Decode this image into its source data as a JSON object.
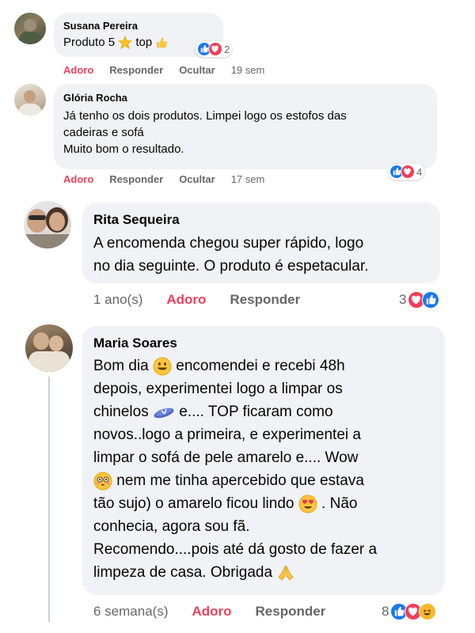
{
  "comments": [
    {
      "author": "Susana Pereira",
      "lines": [
        "Produto 5",
        "top"
      ],
      "actions": {
        "like": "Adoro",
        "reply": "Responder",
        "hide": "Ocultar",
        "time": "19 sem"
      },
      "reactions": {
        "count": "2",
        "types": [
          "like-icon",
          "love-icon"
        ]
      }
    },
    {
      "author": "Glória Rocha",
      "lines": [
        "Já tenho os dois produtos. Limpei logo os estofos das",
        "cadeiras e sofá",
        "Muito bom o resultado."
      ],
      "actions": {
        "like": "Adoro",
        "reply": "Responder",
        "hide": "Ocultar",
        "time": "17 sem"
      },
      "reactions": {
        "count": "4",
        "types": [
          "like-icon",
          "love-icon"
        ]
      }
    },
    {
      "author": "Rita Sequeira",
      "lines": [
        "A encomenda chegou super rápido, logo",
        "no dia seguinte. O produto é espetacular."
      ],
      "actions": {
        "time": "1 ano(s)",
        "like": "Adoro",
        "reply": "Responder"
      },
      "reactions": {
        "count": "3",
        "types": [
          "love-icon",
          "like-icon"
        ]
      }
    },
    {
      "author": "Maria Soares",
      "lines": [
        "Bom dia",
        "encomendei e recebi 48h",
        "depois, experimentei logo a limpar os",
        "chinelos",
        "e.... TOP ficaram como",
        "novos..logo a primeira, e experimentei a",
        "limpar o sofá de pele amarelo e.... Wow",
        "nem me tinha apercebido que estava",
        "tão sujo) o amarelo ficou lindo",
        ". Não",
        "conhecia, agora sou fã.",
        "Recomendo....pois até dá gosto de fazer a",
        "limpeza de casa. Obrigada"
      ],
      "actions": {
        "time": "6 semana(s)",
        "like": "Adoro",
        "reply": "Responder"
      },
      "reactions": {
        "count": "8",
        "types": [
          "like-icon",
          "love-icon",
          "haha-icon"
        ]
      }
    }
  ]
}
